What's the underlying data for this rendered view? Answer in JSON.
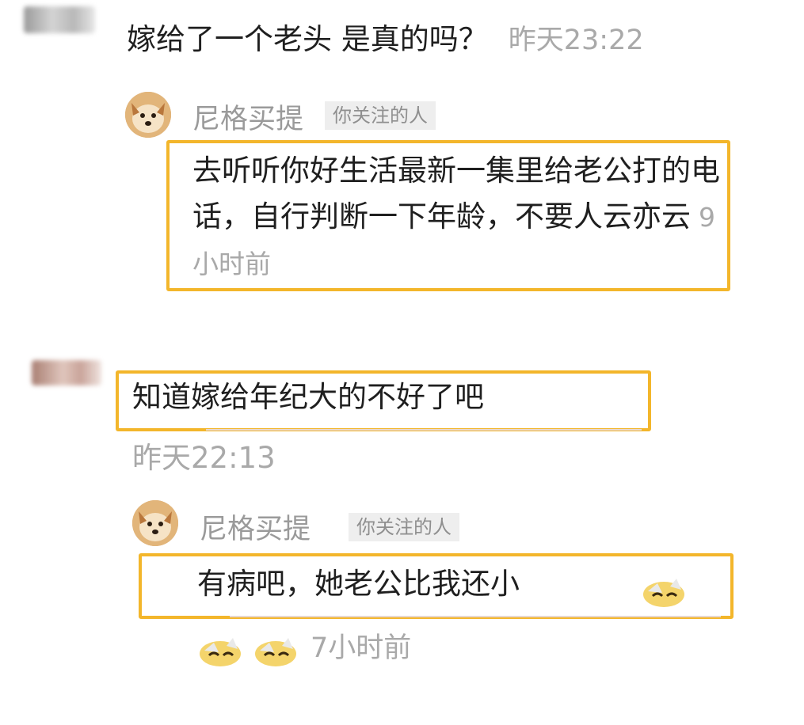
{
  "comment1": {
    "text": "嫁给了一个老头 是真的吗？",
    "time": "昨天23:22"
  },
  "reply1": {
    "name": "尼格买提",
    "tag": "你关注的人",
    "text": "去听听你好生活最新一集里给老公打的电话，自行判断一下年龄，不要人云亦云",
    "time": "9小时前"
  },
  "comment2": {
    "text": "知道嫁给年纪大的不好了吧",
    "time": "昨天22:13"
  },
  "reply2": {
    "name": "尼格买提",
    "tag": "你关注的人",
    "text": "有病吧，她老公比我还小",
    "time": "7小时前"
  },
  "colors": {
    "highlight_box": "#f3b62b",
    "timestamp": "#a9a9a9"
  },
  "icons": {
    "reply_avatar": "dog-avatar-icon",
    "emoji": "laughing-emoji-icon"
  }
}
